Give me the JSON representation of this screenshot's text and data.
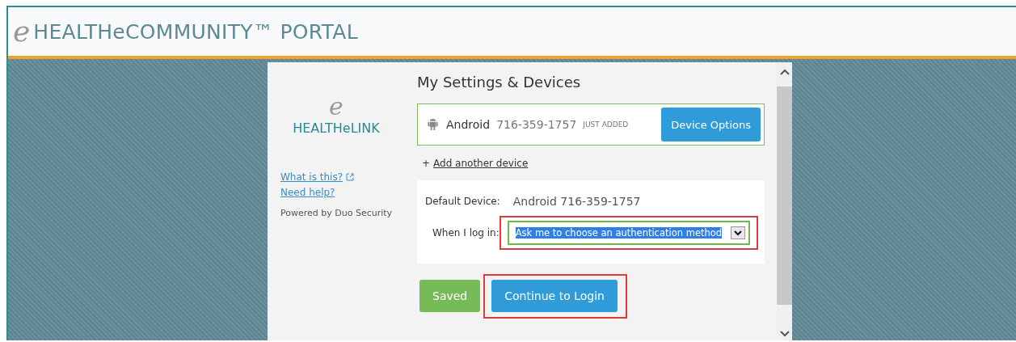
{
  "header": {
    "logo_mark": "e",
    "title": "HEALTHeCOMMUNITY™ PORTAL"
  },
  "sidebar": {
    "logo_mark": "e",
    "logo_text": "HEALTHeLINK",
    "links": [
      "What is this?",
      "Need help?"
    ],
    "powered_by": "Powered by Duo Security"
  },
  "settings": {
    "title": "My Settings & Devices",
    "device": {
      "name": "Android",
      "number": "716-359-1757",
      "badge": "JUST ADDED",
      "button": "Device Options"
    },
    "add_link_prefix": "+",
    "add_link": "Add another device",
    "default_device_label": "Default Device:",
    "default_device_value": "Android 716-359-1757",
    "login_label": "When I log in:",
    "login_select": {
      "value": "Ask me to choose an authentication method",
      "highlighted": true
    },
    "buttons": [
      {
        "label": "Saved",
        "kind": "saved",
        "highlighted": false
      },
      {
        "label": "Continue to Login",
        "kind": "primary",
        "highlighted": true
      }
    ]
  }
}
